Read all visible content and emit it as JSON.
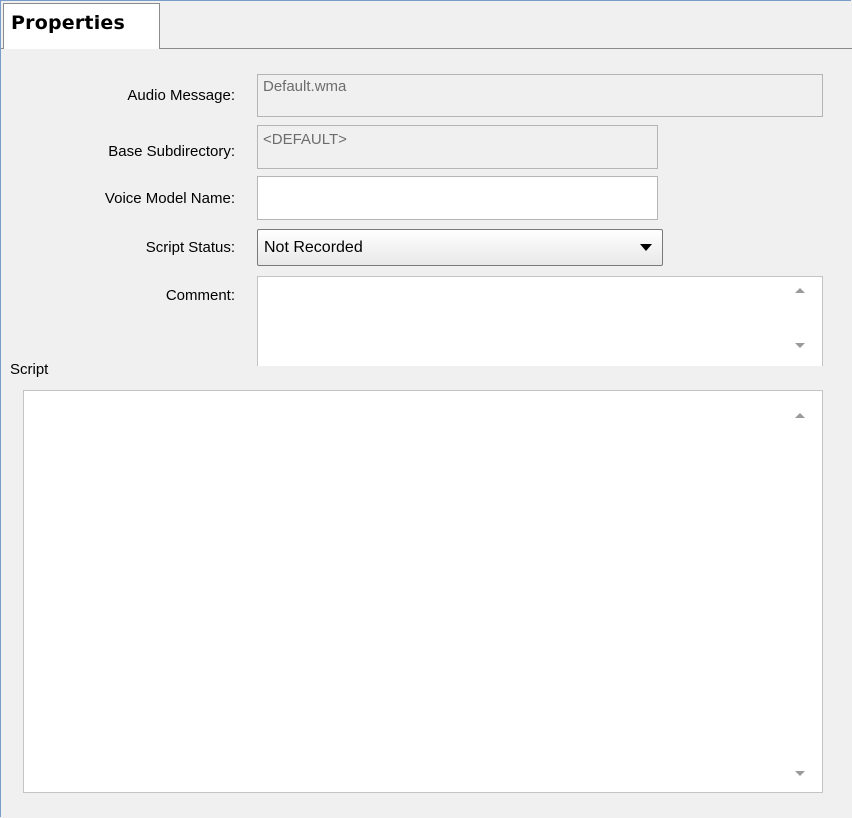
{
  "tab": {
    "label": "Properties"
  },
  "form": {
    "audio_message": {
      "label": "Audio Message:",
      "value": "Default.wma"
    },
    "base_subdirectory": {
      "label": "Base Subdirectory:",
      "value": "<DEFAULT>"
    },
    "voice_model_name": {
      "label": "Voice Model Name:",
      "value": ""
    },
    "script_status": {
      "label": "Script Status:",
      "value": "Not Recorded"
    },
    "comment": {
      "label": "Comment:",
      "value": ""
    }
  },
  "script_section": {
    "label": "Script",
    "value": ""
  },
  "colors": {
    "panel_background": "#f0f0f0",
    "window_border": "#7a9cc8",
    "field_border": "#b5b5b5",
    "readonly_text": "#6d6d6d"
  },
  "icons": {
    "combo": "chevron-down-icon",
    "scroll_up": "scroll-up-arrow-icon",
    "scroll_down": "scroll-down-arrow-icon"
  }
}
